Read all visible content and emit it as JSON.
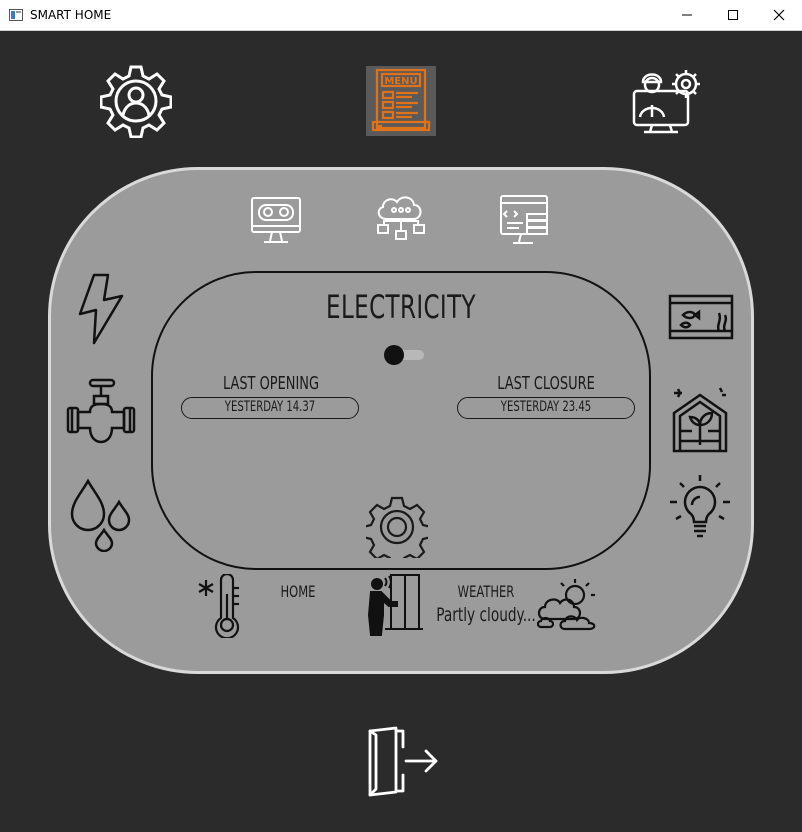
{
  "window": {
    "title": "SMART HOME",
    "controls": {
      "minimize": "minimize",
      "maximize": "maximize",
      "close": "close"
    }
  },
  "top_icons": [
    {
      "name": "user-settings-icon"
    },
    {
      "name": "menu-icon",
      "text": "MENU",
      "color": "#e0721a"
    },
    {
      "name": "technician-icon"
    }
  ],
  "device_icons": [
    "remote-control-monitor-icon",
    "cloud-network-icon",
    "code-server-icon",
    "electricity-icon",
    "water-valve-icon",
    "water-drops-icon",
    "aquarium-icon",
    "greenhouse-icon",
    "light-bulb-icon",
    "settings-gear-icon",
    "thermometer-icon",
    "door-icon",
    "weather-cloud-icon"
  ],
  "main": {
    "heading": "ELECTRICITY",
    "toggle": {
      "on": false
    },
    "last_opening": {
      "label": "LAST OPENING",
      "value": "YESTERDAY  14.37"
    },
    "last_closure": {
      "label": "LAST CLOSURE",
      "value": "YESTERDAY 23.45"
    }
  },
  "bottom": {
    "home_label": "HOME",
    "weather_label": "WEATHER",
    "weather_value": "Partly cloudy..."
  },
  "logout": {
    "name": "logout-icon"
  },
  "colors": {
    "background": "#2b2b2b",
    "panel": "#9b9b9b",
    "panel_border": "#d9d9d9",
    "accent": "#e0721a"
  }
}
